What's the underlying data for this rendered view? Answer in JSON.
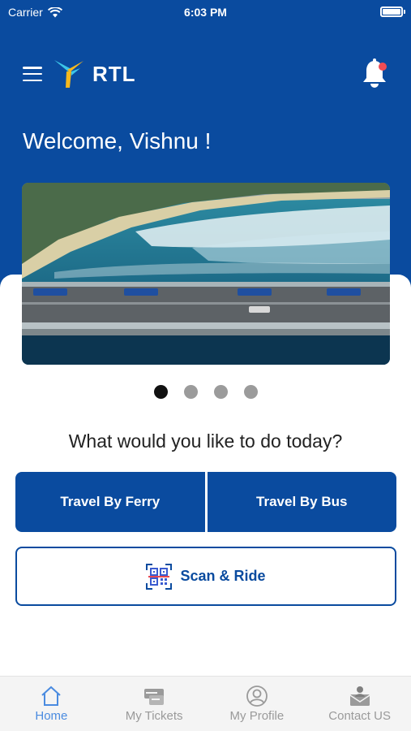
{
  "status_bar": {
    "carrier": "Carrier",
    "time": "6:03 PM",
    "battery_level": 1.0
  },
  "header": {
    "logo_text": "RTL",
    "welcome_text": "Welcome, Vishnu !",
    "notification_badge": true
  },
  "carousel": {
    "total_slides": 4,
    "active_index": 0
  },
  "main": {
    "question": "What would you like to do today?",
    "ferry_label": "Travel By Ferry",
    "bus_label": "Travel By Bus",
    "scan_label": "Scan & Ride"
  },
  "tabs": [
    {
      "label": "Home",
      "icon": "home-icon",
      "active": true
    },
    {
      "label": "My Tickets",
      "icon": "ticket-icon",
      "active": false
    },
    {
      "label": "My Profile",
      "icon": "profile-icon",
      "active": false
    },
    {
      "label": "Contact US",
      "icon": "contact-icon",
      "active": false
    }
  ],
  "colors": {
    "primary": "#0a4b9f",
    "tab_active": "#4a8be0",
    "tab_inactive": "#9a9a9a",
    "badge": "#ef4c54",
    "logo_yellow": "#f6b81d",
    "logo_cyan": "#3cc6e8"
  }
}
